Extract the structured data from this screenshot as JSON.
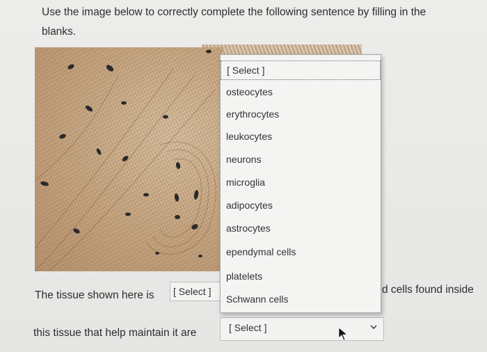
{
  "question": {
    "line1": "Use the image below to correctly complete the following sentence by filling in the",
    "line2": "blanks."
  },
  "sentence": {
    "part1": "The tissue shown here is",
    "part2_fragment": "d cells found inside",
    "part3": "this tissue that help maintain it are"
  },
  "select1": {
    "value": "[ Select ]"
  },
  "select2": {
    "value": "[ Select ]",
    "options": [
      "[ Select ]",
      "osteocytes",
      "erythrocytes",
      "leukocytes",
      "neurons",
      "microglia",
      "adipocytes",
      "astrocytes",
      "ependymal cells",
      "platelets",
      "Schwann cells"
    ]
  },
  "icons": {
    "dropdown": "chevron-down-icon",
    "cursor": "mouse-cursor-icon"
  },
  "colors": {
    "page_bg": "#e9e9e7",
    "tissue": "#c9a985",
    "nucleus": "#2a2a2a"
  }
}
